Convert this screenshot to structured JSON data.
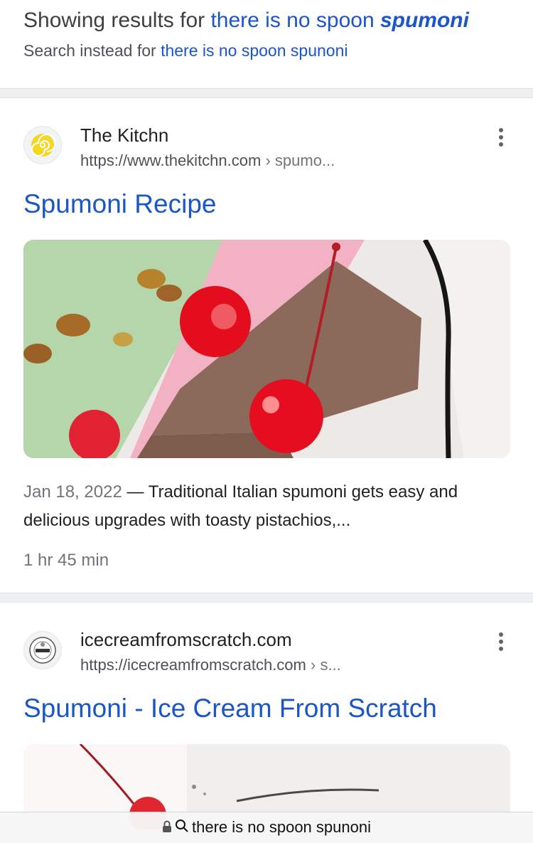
{
  "spelling": {
    "showing_prefix": "Showing results for",
    "corrected_plain": "there is no spoon",
    "corrected_bold": "spumoni",
    "instead_prefix": "Search instead for",
    "original_query": "there is no spoon spunoni"
  },
  "results": [
    {
      "site_name": "The Kitchn",
      "url": "https://www.thekitchn.com",
      "url_path": "› spumo...",
      "favicon": "spiral-icon",
      "title": "Spumoni Recipe",
      "image": "spumoni-slice-with-cherries",
      "date": "Jan 18, 2022",
      "snippet": " — Traditional Italian spumoni gets easy and delicious upgrades with toasty pistachios,...",
      "total_time": "1 hr 45 min"
    },
    {
      "site_name": "icecreamfromscratch.com",
      "url": "https://icecreamfromscratch.com",
      "url_path": "› s...",
      "favicon": "seal-icon",
      "title": "Spumoni - Ice Cream From Scratch",
      "image": "spumoni-with-cherry-stem"
    }
  ],
  "address_bar": {
    "text": "there is no spoon spunoni",
    "lock_icon": "lock-icon",
    "search_icon": "search-icon"
  },
  "colors": {
    "link": "#1a56c9",
    "separator": "#eeeff1",
    "kitchn_yellow": "#f5d623"
  }
}
